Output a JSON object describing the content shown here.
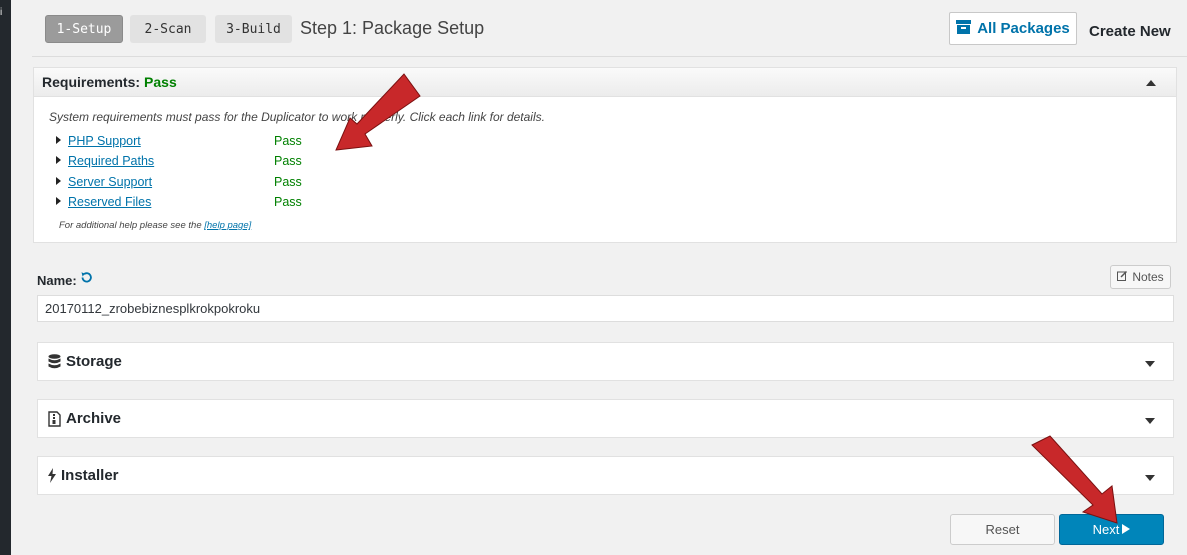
{
  "sidebar_char": "i",
  "steps": [
    {
      "label": "1-Setup"
    },
    {
      "label": "2-Scan"
    },
    {
      "label": "3-Build"
    }
  ],
  "step_title": "Step 1: Package Setup",
  "header": {
    "all_packages_label": "All Packages",
    "create_new_label": "Create New"
  },
  "requirements": {
    "title": "Requirements:",
    "status": "Pass",
    "intro": "System requirements must pass for the Duplicator to work properly. Click each link for details.",
    "items": [
      {
        "label": "PHP Support",
        "result": "Pass"
      },
      {
        "label": "Required Paths",
        "result": "Pass"
      },
      {
        "label": "Server Support",
        "result": "Pass"
      },
      {
        "label": "Reserved Files",
        "result": "Pass"
      }
    ],
    "help_prefix": "For additional help please see the",
    "help_link": "[help page]"
  },
  "name_section": {
    "label": "Name:",
    "value": "20170112_zrobebiznesplkrokpokroku",
    "notes_label": "Notes"
  },
  "sections": [
    {
      "label": "Storage",
      "icon": "database-icon"
    },
    {
      "label": "Archive",
      "icon": "file-archive-icon"
    },
    {
      "label": "Installer",
      "icon": "bolt-icon"
    }
  ],
  "footer": {
    "reset_label": "Reset",
    "next_label": "Next"
  },
  "colors": {
    "accent": "#0073aa",
    "pass": "#008000",
    "primary_button": "#0085ba",
    "arrow_red": "#c8282a"
  }
}
